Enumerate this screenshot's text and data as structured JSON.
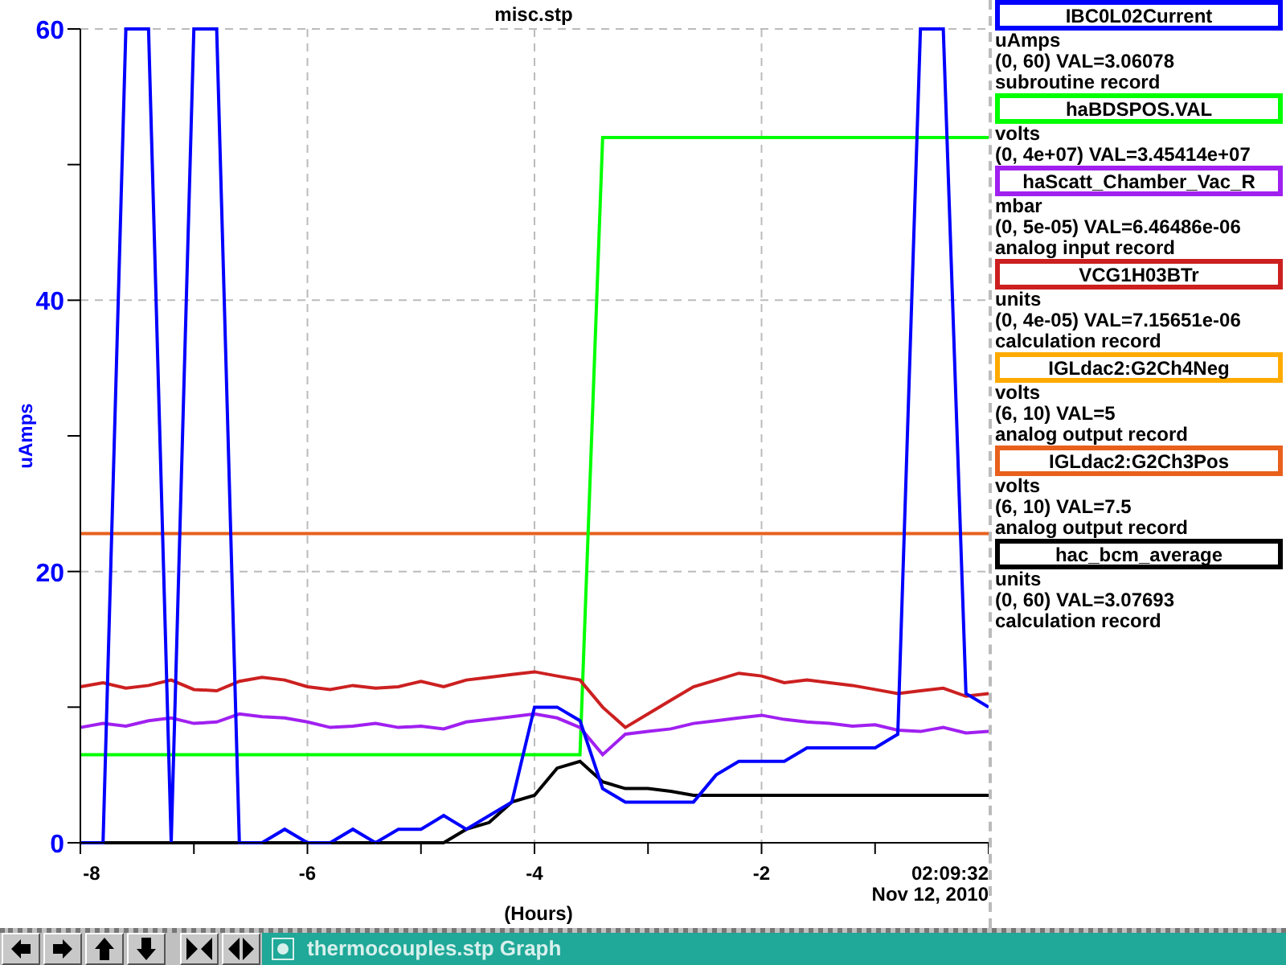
{
  "plot": {
    "chart_data": {
      "type": "line",
      "title": "misc.stp",
      "xlabel": "(Hours)",
      "ylabel": "uAmps",
      "xlim": [
        -8,
        0
      ],
      "ylim": [
        0,
        60
      ],
      "xticks": [
        -8,
        -6,
        -4,
        -2
      ],
      "yticks": [
        0,
        20,
        40,
        60
      ],
      "grid": true,
      "x": [
        -8,
        -7.8,
        -7.6,
        -7.4,
        -7.2,
        -7,
        -6.8,
        -6.6,
        -6.4,
        -6.2,
        -6,
        -5.8,
        -5.6,
        -5.4,
        -5.2,
        -5,
        -4.8,
        -4.6,
        -4.4,
        -4.2,
        -4,
        -3.8,
        -3.6,
        -3.4,
        -3.2,
        -3,
        -2.8,
        -2.6,
        -2.4,
        -2.2,
        -2,
        -1.8,
        -1.6,
        -1.4,
        -1.2,
        -1,
        -0.8,
        -0.6,
        -0.4,
        -0.2,
        0
      ],
      "series": [
        {
          "color": "#e8601c",
          "values": [
            22.8,
            22.8,
            22.8,
            22.8,
            22.8,
            22.8,
            22.8,
            22.8,
            22.8,
            22.8,
            22.8,
            22.8,
            22.8,
            22.8,
            22.8,
            22.8,
            22.8,
            22.8,
            22.8,
            22.8,
            22.8,
            22.8,
            22.8,
            22.8,
            22.8,
            22.8,
            22.8,
            22.8,
            22.8,
            22.8,
            22.8,
            22.8,
            22.8,
            22.8,
            22.8,
            22.8,
            22.8,
            22.8,
            22.8,
            22.8,
            22.8
          ]
        },
        {
          "color": "#00ff00",
          "values": [
            6.5,
            6.5,
            6.5,
            6.5,
            6.5,
            6.5,
            6.5,
            6.5,
            6.5,
            6.5,
            6.5,
            6.5,
            6.5,
            6.5,
            6.5,
            6.5,
            6.5,
            6.5,
            6.5,
            6.5,
            6.5,
            6.5,
            6.5,
            52,
            52,
            52,
            52,
            52,
            52,
            52,
            52,
            52,
            52,
            52,
            52,
            52,
            52,
            52,
            52,
            52,
            52
          ]
        },
        {
          "color": "#cc2020",
          "values": [
            11.5,
            11.8,
            11.4,
            11.6,
            12,
            11.3,
            11.2,
            11.9,
            12.2,
            12,
            11.5,
            11.3,
            11.6,
            11.4,
            11.5,
            11.9,
            11.5,
            12,
            12.2,
            12.4,
            12.6,
            12.3,
            12,
            10,
            8.5,
            9.5,
            10.5,
            11.5,
            12,
            12.5,
            12.3,
            11.8,
            12,
            11.8,
            11.6,
            11.3,
            11,
            11.2,
            11.4,
            10.8,
            11
          ]
        },
        {
          "color": "#a020f0",
          "values": [
            8.5,
            8.8,
            8.6,
            9,
            9.2,
            8.8,
            8.9,
            9.5,
            9.3,
            9.2,
            8.9,
            8.5,
            8.6,
            8.8,
            8.5,
            8.6,
            8.4,
            8.9,
            9.1,
            9.3,
            9.5,
            9.2,
            8.5,
            6.5,
            8,
            8.2,
            8.4,
            8.8,
            9,
            9.2,
            9.4,
            9.1,
            8.9,
            8.8,
            8.6,
            8.7,
            8.3,
            8.2,
            8.5,
            8.1,
            8.2
          ]
        },
        {
          "color": "#000000",
          "values": [
            0,
            0,
            0,
            0,
            0,
            0,
            0,
            0,
            0,
            0,
            0,
            0,
            0,
            0,
            0,
            0,
            0,
            1,
            1.5,
            3,
            3.5,
            5.5,
            6,
            4.5,
            4,
            4,
            3.8,
            3.5,
            3.5,
            3.5,
            3.5,
            3.5,
            3.5,
            3.5,
            3.5,
            3.5,
            3.5,
            3.5,
            3.5,
            3.5,
            3.5
          ]
        },
        {
          "color": "#0000ff",
          "values": [
            0,
            0,
            60,
            60,
            0,
            60,
            60,
            0,
            0,
            1,
            0,
            0,
            1,
            0,
            1,
            1,
            2,
            1,
            2,
            3,
            10,
            10,
            9,
            4,
            3,
            3,
            3,
            3,
            5,
            6,
            6,
            6,
            7,
            7,
            7,
            7,
            8,
            60,
            60,
            11,
            10
          ]
        }
      ]
    },
    "time": "02:09:32",
    "date": "Nov 12, 2010"
  },
  "traces": [
    {
      "name": "IBC0L02Current",
      "color": "#0000ff",
      "units": "uAmps",
      "range_value": "(0, 60) VAL=3.06078",
      "description": "subroutine record"
    },
    {
      "name": "haBDSPOS.VAL",
      "color": "#00ff00",
      "units": "volts",
      "range_value": "(0, 4e+07) VAL=3.45414e+07"
    },
    {
      "name": "haScatt_Chamber_Vac_R",
      "color": "#a020f0",
      "units": "mbar",
      "range_value": "(0, 5e-05) VAL=6.46486e-06",
      "description": "analog input record"
    },
    {
      "name": "VCG1H03BTr",
      "color": "#cc2020",
      "units": "units",
      "range_value": "(0, 4e-05) VAL=7.15651e-06",
      "description": "calculation record"
    },
    {
      "name": "IGLdac2:G2Ch4Neg",
      "color": "#ffaa00",
      "units": "volts",
      "range_value": "(6, 10) VAL=5",
      "description": "analog output record"
    },
    {
      "name": "IGLdac2:G2Ch3Pos",
      "color": "#e8601c",
      "units": "volts",
      "range_value": "(6, 10) VAL=7.5",
      "description": "analog output record"
    },
    {
      "name": "hac_bcm_average",
      "color": "#000000",
      "units": "units",
      "range_value": "(0, 60) VAL=3.07693",
      "description": "calculation record"
    }
  ],
  "taskbar": {
    "buttons": [
      {
        "kind": "left"
      },
      {
        "kind": "right"
      },
      {
        "kind": "up"
      },
      {
        "kind": "down"
      },
      {
        "kind": "inward"
      },
      {
        "kind": "outward"
      }
    ],
    "task": {
      "label": "thermocouples.stp Graph",
      "selected": true
    }
  }
}
